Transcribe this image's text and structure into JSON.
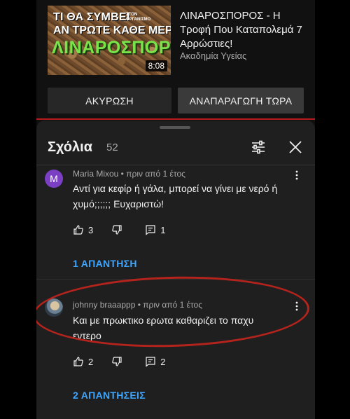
{
  "upnext": {
    "thumb_line1": "ΤΙ ΘΑ ΣΥΜΒΕΙ",
    "thumb_line1_small": "ΣΤΟΝ ΟΡΓΑΝΙΣΜΟ",
    "thumb_line2": "ΑΝ ΤΡΩΤΕ ΚΑΘΕ ΜΕΡΑ",
    "thumb_line3": "ΛΙΝΑΡΟΣΠΟΡΟ;",
    "duration": "8:08",
    "title": "ΛΙΝΑΡΟΣΠΟΡΟΣ - Η Τροφή Που Καταπολεμά 7 Αρρώστιες!",
    "channel": "Ακαδημία Υγείας",
    "cancel_label": "ΑΚΥΡΩΣΗ",
    "play_label": "ΑΝΑΠΑΡΑΓΩΓΗ ΤΩΡΑ"
  },
  "comments_panel": {
    "title": "Σχόλια",
    "count": "52",
    "icons": {
      "filter": "filter-icon",
      "close": "close-icon"
    }
  },
  "comments": [
    {
      "avatar_letter": "M",
      "avatar_color": "#7b3fc4",
      "meta": "Maria Mixou • πριν από 1 έτος",
      "text": "Αντί για κεφίρ ή γάλα, μπορεί να γίνει με νερό ή χυμό;;;;;; Ευχαριστώ!",
      "likes": "3",
      "replies_count": "1",
      "replies_link": "1 ΑΠΑΝΤΗΣΗ"
    },
    {
      "meta": "johnny braaappp • πριν από 1 έτος",
      "text": "Και με πρωκτικο ερωτα καθαριζει το παχυ εντερο",
      "likes": "2",
      "replies_count": "2",
      "replies_link": "2 ΑΠΑΝΤΗΣΕΙΣ"
    }
  ],
  "colors": {
    "accent_link": "#3ea6ff",
    "annotation": "#b4231c",
    "progress_bar": "#b81b1b"
  }
}
